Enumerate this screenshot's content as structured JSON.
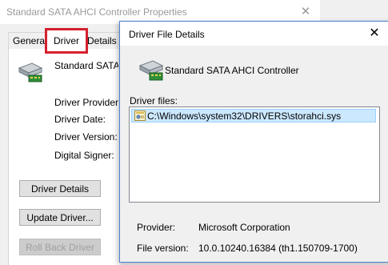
{
  "properties_window": {
    "title": "Standard SATA AHCI Controller Properties",
    "close_glyph": "✕",
    "tabs": {
      "general": "General",
      "driver": "Driver",
      "details": "Details"
    },
    "device_name": "Standard SATA A",
    "labels": {
      "provider": "Driver Provider:",
      "date": "Driver Date:",
      "version": "Driver Version:",
      "signer": "Digital Signer:"
    },
    "buttons": {
      "driver_details": "Driver Details",
      "update_driver": "Update Driver...",
      "roll_back_driver": "Roll Back Driver"
    },
    "highlight_color": "#d6202d"
  },
  "file_details_dialog": {
    "title": "Driver File Details",
    "close_glyph": "✕",
    "device_name": "Standard SATA AHCI Controller",
    "files_label": "Driver files:",
    "files": [
      {
        "path": "C:\\Windows\\system32\\DRIVERS\\storahci.sys",
        "selected": true,
        "icon": "system-file-icon"
      }
    ],
    "provider_label": "Provider:",
    "provider_value": "Microsoft Corporation",
    "version_label": "File version:",
    "version_value": "10.0.10240.16384 (th1.150709-1700)",
    "selection_color": "#cce8ff",
    "accent_color": "#4a7fd0"
  }
}
